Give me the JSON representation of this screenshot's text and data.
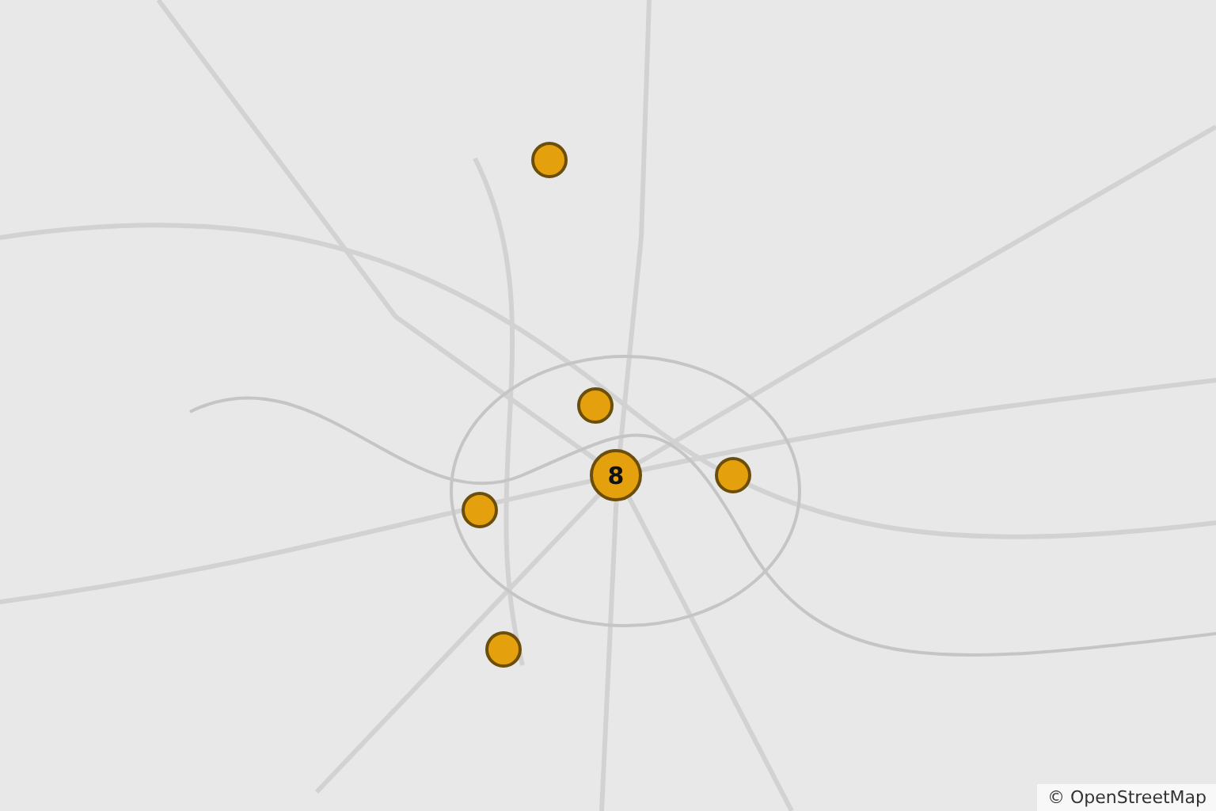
{
  "map": {
    "markers": [
      {
        "kind": "point"
      },
      {
        "kind": "point"
      },
      {
        "kind": "cluster",
        "count": "8"
      },
      {
        "kind": "point"
      },
      {
        "kind": "point"
      },
      {
        "kind": "point"
      }
    ],
    "attribution": "© OpenStreetMap"
  }
}
